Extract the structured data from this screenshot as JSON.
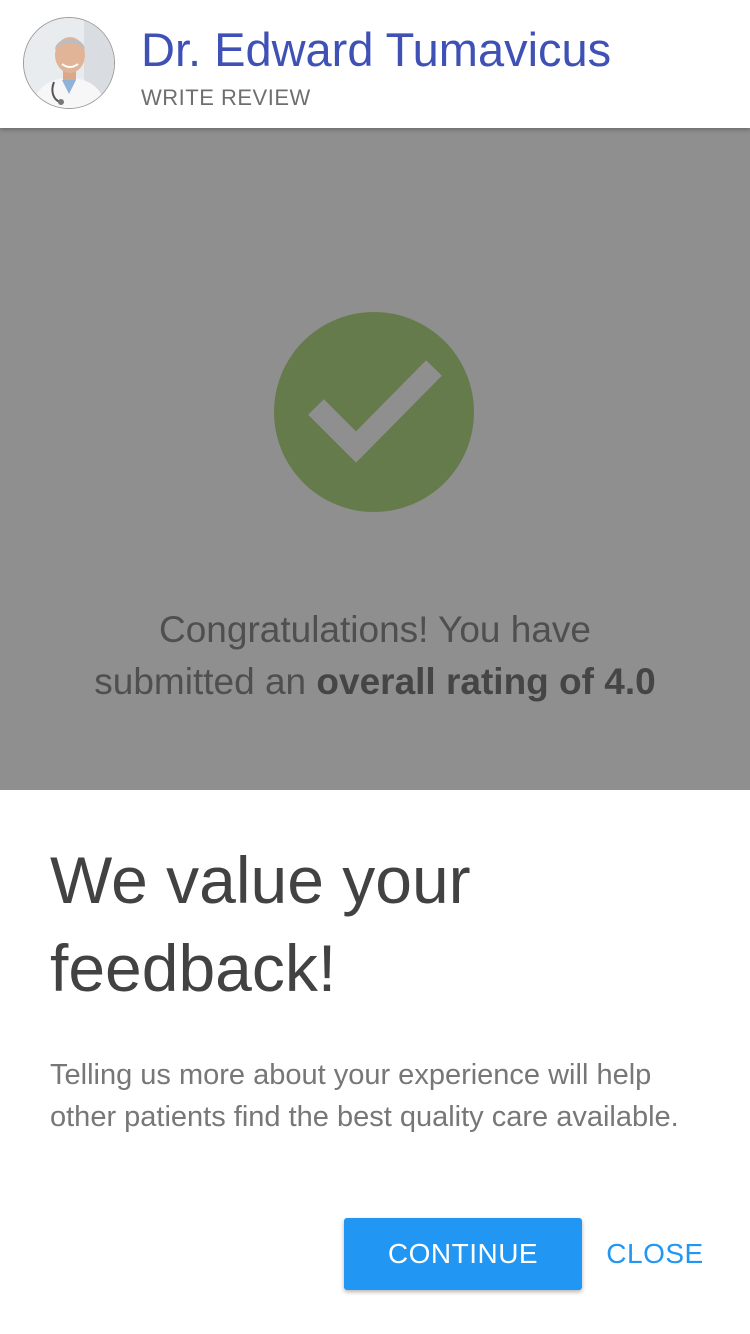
{
  "header": {
    "doctor_name": "Dr. Edward Tumavicus",
    "subtitle": "WRITE REVIEW",
    "title_color": "#3f51b5"
  },
  "confirmation": {
    "icon": "checkmark-icon",
    "icon_color": "#667b4c",
    "line1": "Congratulations! You have",
    "line2_prefix": "submitted an ",
    "line2_bold": "overall rating of 4.0"
  },
  "sheet": {
    "title": "We value your feedback!",
    "body": "Telling us more about your experience will help other patients find the best quality care available.",
    "continue_label": "CONTINUE",
    "close_label": "CLOSE",
    "accent_color": "#2196f3"
  }
}
